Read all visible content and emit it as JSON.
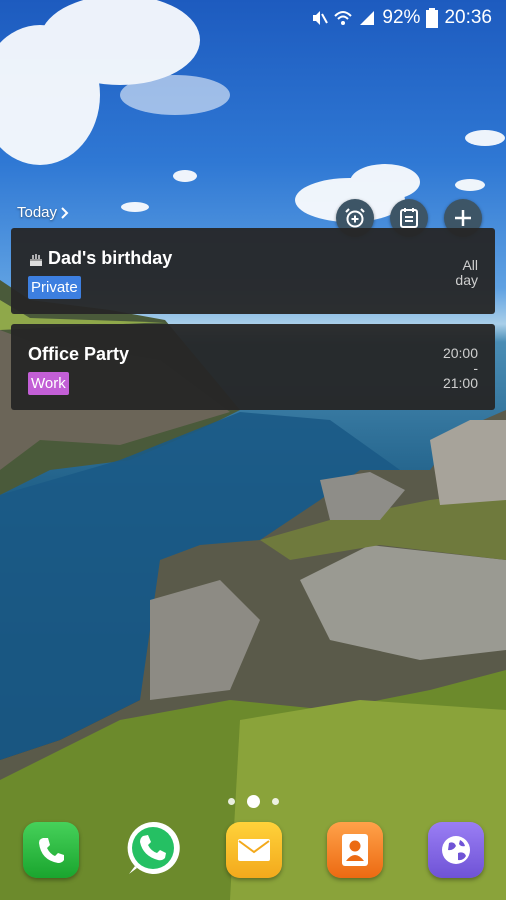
{
  "status_bar": {
    "battery_percent": "92%",
    "time": "20:36",
    "icons": [
      "mute-icon",
      "wifi-icon",
      "signal-icon",
      "battery-icon"
    ]
  },
  "widget": {
    "today_label": "Today",
    "actions": [
      "alarm-add-icon",
      "calendar-icon",
      "plus-icon"
    ],
    "events": [
      {
        "title": "Dad's birthday",
        "tag": "Private",
        "tag_color": "#3d7fe0",
        "time_line1": "All",
        "time_line2": "day",
        "icon": "cake-icon"
      },
      {
        "title": "Office Party",
        "tag": "Work",
        "tag_color": "#c35fd6",
        "time_line1": "20:00",
        "time_sep": "-",
        "time_line2": "21:00"
      }
    ]
  },
  "home": {
    "pages": 3,
    "active_page": 2
  },
  "dock": {
    "apps": [
      "Phone",
      "WhatsApp",
      "Email",
      "Contacts",
      "Internet"
    ],
    "icons": [
      "phone-icon",
      "whatsapp-icon",
      "email-icon",
      "contacts-icon",
      "internet-icon"
    ]
  }
}
